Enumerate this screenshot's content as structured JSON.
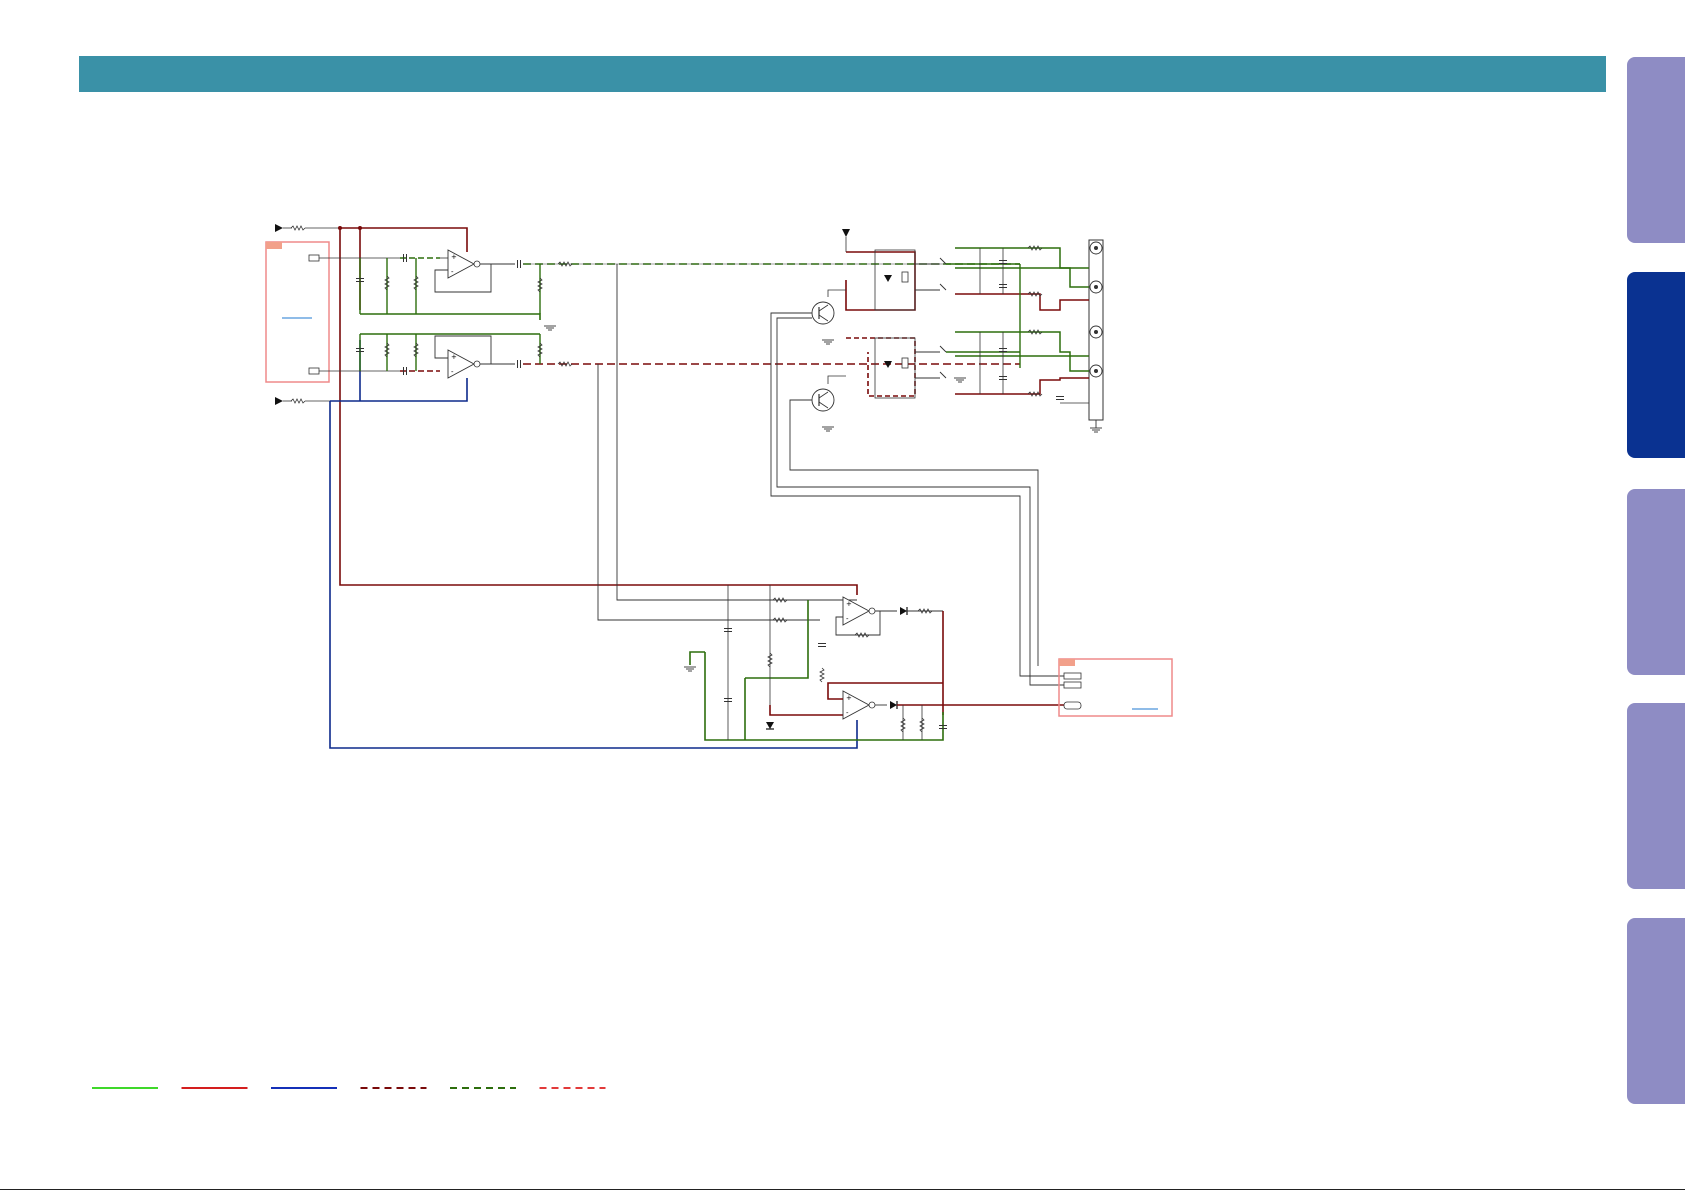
{
  "header": {
    "color": "#3a91a7"
  },
  "colors": {
    "green": "#2d6e0d",
    "darkred": "#7a0a0a",
    "navy": "#0d2a8c",
    "legend_lime": "#3fd82a",
    "legend_red": "#d41e1e",
    "legend_blue": "#1430b8",
    "legend_dashed_darkred": "#7a0a0a",
    "legend_dashed_green": "#2d6e0d",
    "legend_dashed_red": "#e23a3a",
    "connector_box": "#ef8a8a",
    "connector_tag": "#f2a08a",
    "link": "#1f7ad0",
    "tab_inactive": "#8e8cc4",
    "tab_active": "#0a3291"
  },
  "side_tabs": [
    {
      "id": "tab-1",
      "active": false
    },
    {
      "id": "tab-2",
      "active": true
    },
    {
      "id": "tab-3",
      "active": false
    },
    {
      "id": "tab-4",
      "active": false
    },
    {
      "id": "tab-5",
      "active": false
    }
  ],
  "legend": [
    {
      "style": "solid",
      "color_key": "legend_lime"
    },
    {
      "style": "solid",
      "color_key": "legend_red"
    },
    {
      "style": "solid",
      "color_key": "legend_blue"
    },
    {
      "style": "dashed",
      "color_key": "legend_dashed_darkred"
    },
    {
      "style": "dashed",
      "color_key": "legend_dashed_green"
    },
    {
      "style": "dashed",
      "color_key": "legend_dashed_red"
    }
  ]
}
